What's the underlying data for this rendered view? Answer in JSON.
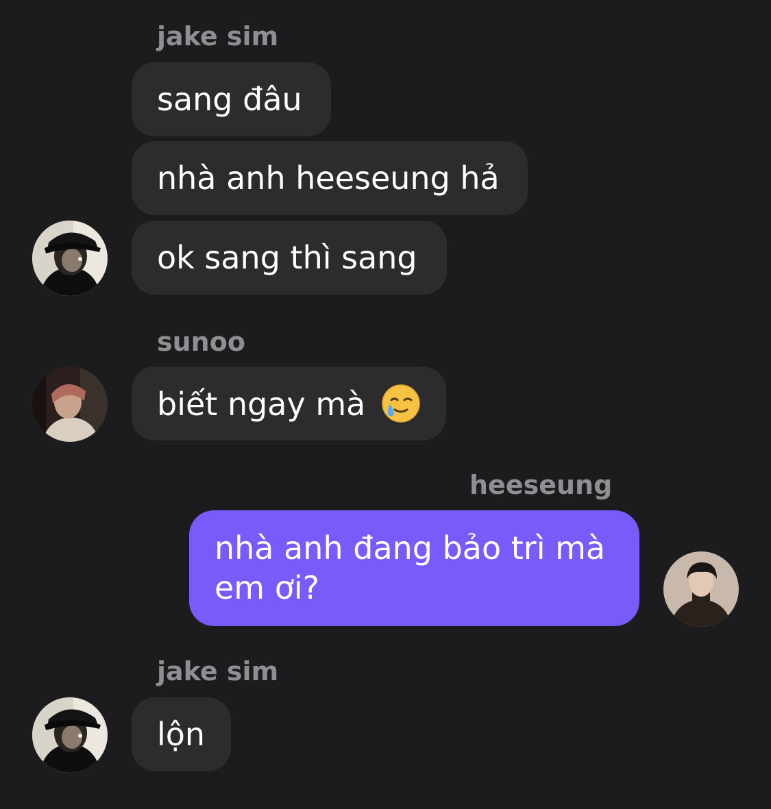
{
  "messages": {
    "group1": {
      "sender": "jake sim",
      "lines": [
        "sang đâu",
        "nhà anh heeseung hả",
        "ok sang thì sang"
      ]
    },
    "group2": {
      "sender": "sunoo",
      "text": "biết ngay mà",
      "emoji": "smiling-face-with-tear-icon"
    },
    "group3": {
      "sender": "heeseung",
      "text": "nhà anh đang bảo trì mà em ơi?"
    },
    "group4": {
      "sender": "jake sim",
      "text": "lộn"
    }
  },
  "colors": {
    "background": "#1c1c1e",
    "incoming_bubble": "#2c2c2e",
    "outgoing_bubble": "#7a5af8",
    "sender_name": "#8e8e93"
  }
}
